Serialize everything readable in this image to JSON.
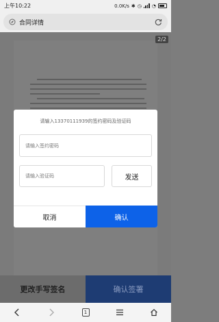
{
  "status_bar": {
    "time": "上午10:22",
    "network_speed": "0.0K/s"
  },
  "address_bar": {
    "title": "合同详情"
  },
  "document": {
    "page_counter": "2/2"
  },
  "bottom_actions": {
    "change_signature_label": "更改手写签名",
    "confirm_sign_label": "确认签署"
  },
  "nav_bar": {
    "tab_count": "1"
  },
  "modal": {
    "prompt": "请输入13370111939的签约密码及验证码",
    "password_placeholder": "请输入签约密码",
    "code_placeholder": "请输入验证码",
    "send_label": "发送",
    "cancel_label": "取消",
    "confirm_label": "确认"
  },
  "colors": {
    "confirm_blue": "#0d62e8",
    "sign_bar_navy": "#1e3c73",
    "overlay_gray": "#7b7b7b"
  }
}
